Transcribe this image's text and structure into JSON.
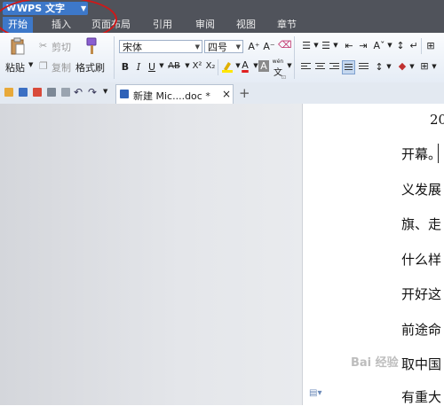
{
  "app": {
    "title": "WPS 文字",
    "logo_icon": "wps-w-icon"
  },
  "menu": {
    "tabs": [
      "开始",
      "插入",
      "页面布局",
      "引用",
      "审阅",
      "视图",
      "章节"
    ],
    "active": "开始"
  },
  "ribbon": {
    "paste_label": "粘贴",
    "cut_label": "剪切",
    "copy_label": "复制",
    "format_painter_label": "格式刷",
    "font_name": "宋体",
    "font_size": "四号",
    "grow_font": "A⁺",
    "shrink_font": "A⁻",
    "bold": "B",
    "italic": "I",
    "underline": "U",
    "strike": "AB",
    "superscript": "X²",
    "subscript": "X₂",
    "font_color_glyph": "A",
    "char_shading_glyph": "A",
    "phonetic_glyph": "wén"
  },
  "document": {
    "tab_title": "新建 Mic....doc *",
    "close_glyph": "×",
    "new_tab_glyph": "+",
    "lines": [
      "20",
      "开幕。",
      "义发展",
      "旗、走",
      "什么样",
      "开好这",
      "前途命",
      "取中国",
      "有重大"
    ]
  },
  "watermark": "Bai 经验",
  "colors": {
    "accent": "#3d78c9",
    "menubar": "#50535b",
    "annotation": "#d01818"
  }
}
